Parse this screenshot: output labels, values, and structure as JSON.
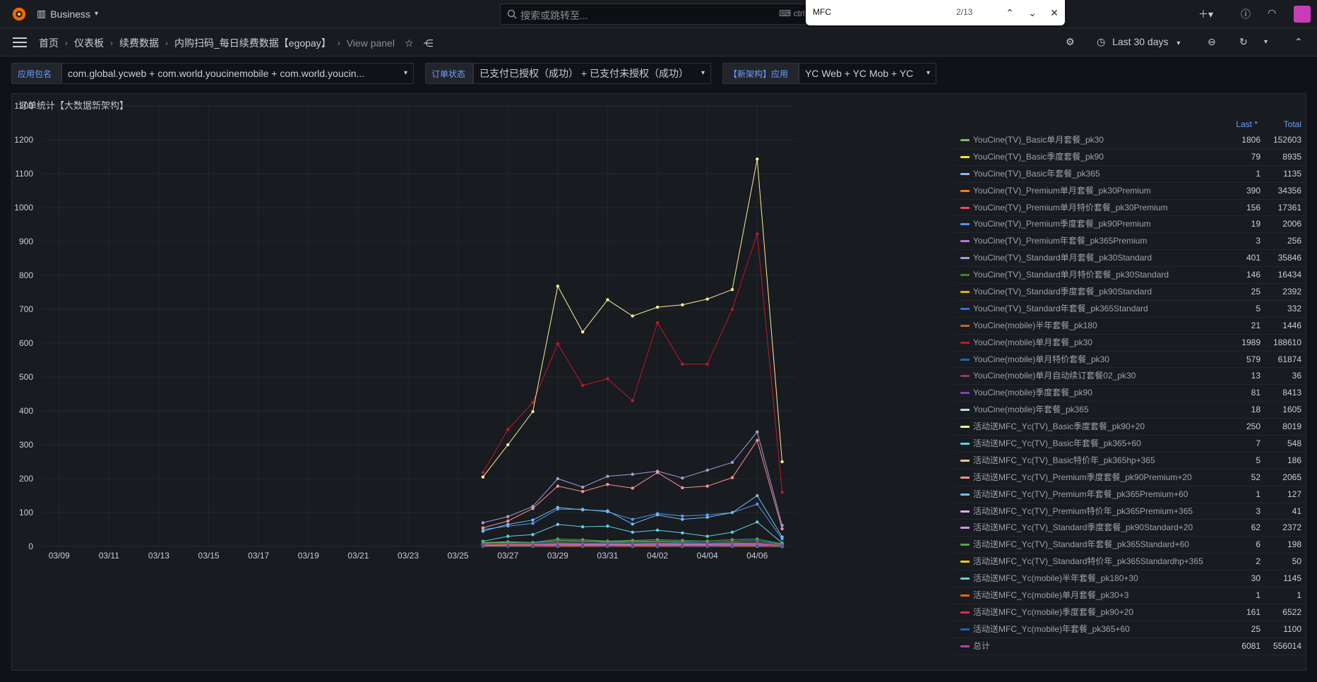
{
  "topbar": {
    "org": "Business",
    "search_placeholder": "搜索或跳转至...",
    "search_shortcut": "ctrl",
    "find": {
      "query": "MFC",
      "count": "2/13"
    }
  },
  "breadcrumb": [
    "首页",
    "仪表板",
    "续费数据",
    "内购扫码_每日续费数据【egopay】",
    "View panel"
  ],
  "time_range": "Last 30 days",
  "variables": [
    {
      "label": "应用包名",
      "value": "com.global.ycweb + com.world.youcinemobile + com.world.youcin..."
    },
    {
      "label": "订单状态",
      "value": "已支付已授权（成功） + 已支付未授权（成功）"
    },
    {
      "label": "【新架构】应用",
      "value": "YC Web + YC Mob + YC"
    }
  ],
  "panel": {
    "title": "订单统计【大数据新架构】"
  },
  "legend_header": {
    "last": "Last *",
    "total": "Total"
  },
  "colors": {
    "background": "#111217",
    "panel": "#181b1f",
    "accent": "#6e9fff"
  },
  "chart_data": {
    "type": "line",
    "x": [
      "03/26",
      "03/27",
      "03/28",
      "03/29",
      "03/30",
      "03/31",
      "04/01",
      "04/02",
      "04/03",
      "04/04",
      "04/05",
      "04/06",
      "04/07"
    ],
    "x_range": [
      "03/08",
      "04/07"
    ],
    "x_ticks": [
      "03/09",
      "03/11",
      "03/13",
      "03/15",
      "03/17",
      "03/19",
      "03/21",
      "03/23",
      "03/25",
      "03/27",
      "03/29",
      "03/31",
      "04/02",
      "04/04",
      "04/06"
    ],
    "y_ticks": [
      0,
      100,
      200,
      300,
      400,
      500,
      600,
      700,
      800,
      900,
      1000,
      1100,
      1200,
      1300
    ],
    "ylim": [
      0,
      1300
    ],
    "grid": true,
    "legend_placement": "right",
    "series": [
      {
        "name": "YouCine(TV)_Basic单月套餐_pk30",
        "color": "#73bf69",
        "last": "1806",
        "total": "152603",
        "values": [
          10,
          12,
          10,
          18,
          16,
          14,
          15,
          16,
          14,
          12,
          15,
          18,
          6
        ]
      },
      {
        "name": "YouCine(TV)_Basic季度套餐_pk90",
        "color": "#fade2a",
        "last": "79",
        "total": "8935",
        "values": [
          3,
          3,
          3,
          4,
          4,
          3,
          4,
          4,
          3,
          3,
          4,
          4,
          2
        ]
      },
      {
        "name": "YouCine(TV)_Basic年套餐_pk365",
        "color": "#8ab8ff",
        "last": "1",
        "total": "1135",
        "values": [
          1,
          1,
          1,
          1,
          1,
          1,
          1,
          1,
          1,
          1,
          1,
          1,
          0
        ]
      },
      {
        "name": "YouCine(TV)_Premium单月套餐_pk30Premium",
        "color": "#ff780a",
        "last": "390",
        "total": "34356",
        "values": [
          5,
          6,
          6,
          8,
          8,
          7,
          7,
          8,
          7,
          7,
          8,
          9,
          3
        ]
      },
      {
        "name": "YouCine(TV)_Premium单月特价套餐_pk30Premium",
        "color": "#f2495c",
        "last": "156",
        "total": "17361",
        "values": [
          3,
          4,
          4,
          5,
          5,
          4,
          5,
          5,
          4,
          4,
          5,
          6,
          2
        ]
      },
      {
        "name": "YouCine(TV)_Premium季度套餐_pk90Premium",
        "color": "#5794f2",
        "last": "19",
        "total": "2006",
        "values": [
          50,
          60,
          68,
          110,
          110,
          102,
          80,
          97,
          90,
          93,
          100,
          125,
          22
        ]
      },
      {
        "name": "YouCine(TV)_Premium年套餐_pk365Premium",
        "color": "#b877d9",
        "last": "3",
        "total": "256",
        "values": [
          1,
          1,
          1,
          1,
          1,
          1,
          1,
          1,
          1,
          1,
          1,
          1,
          0
        ]
      },
      {
        "name": "YouCine(TV)_Standard单月套餐_pk30Standard",
        "color": "#9f9fd6",
        "last": "401",
        "total": "35846",
        "values": [
          70,
          88,
          118,
          200,
          175,
          207,
          213,
          222,
          202,
          225,
          248,
          338,
          62
        ]
      },
      {
        "name": "YouCine(TV)_Standard单月特价套餐_pk30Standard",
        "color": "#37872d",
        "last": "146",
        "total": "16434",
        "values": [
          6,
          8,
          8,
          12,
          10,
          10,
          11,
          11,
          10,
          9,
          11,
          14,
          4
        ]
      },
      {
        "name": "YouCine(TV)_Standard季度套餐_pk90Standard",
        "color": "#e0b400",
        "last": "25",
        "total": "2392",
        "values": [
          2,
          2,
          2,
          3,
          3,
          2,
          3,
          3,
          2,
          2,
          3,
          3,
          1
        ]
      },
      {
        "name": "YouCine(TV)_Standard年套餐_pk365Standard",
        "color": "#3274d9",
        "last": "5",
        "total": "332",
        "values": [
          1,
          1,
          1,
          1,
          1,
          1,
          1,
          1,
          1,
          1,
          1,
          1,
          0
        ]
      },
      {
        "name": "YouCine(mobile)半年套餐_pk180",
        "color": "#c4632c",
        "last": "21",
        "total": "1446",
        "values": [
          2,
          2,
          2,
          3,
          3,
          2,
          3,
          3,
          2,
          2,
          3,
          3,
          1
        ]
      },
      {
        "name": "YouCine(mobile)单月套餐_pk30",
        "color": "#c4162a",
        "last": "1989",
        "total": "188610",
        "values": [
          218,
          345,
          425,
          598,
          475,
          495,
          430,
          660,
          538,
          538,
          700,
          922,
          160
        ]
      },
      {
        "name": "YouCine(mobile)单月特价套餐_pk30",
        "color": "#1f60c4",
        "last": "579",
        "total": "61874",
        "values": [
          8,
          10,
          10,
          15,
          14,
          12,
          13,
          14,
          12,
          12,
          14,
          18,
          5
        ]
      },
      {
        "name": "YouCine(mobile)单月自动续订套餐02_pk30",
        "color": "#8f3b5c",
        "last": "13",
        "total": "36",
        "values": [
          0,
          0,
          0,
          1,
          1,
          1,
          1,
          1,
          1,
          1,
          1,
          1,
          0
        ]
      },
      {
        "name": "YouCine(mobile)季度套餐_pk90",
        "color": "#8f3bb8",
        "last": "81",
        "total": "8413",
        "values": [
          3,
          4,
          4,
          5,
          5,
          4,
          5,
          5,
          4,
          4,
          5,
          6,
          2
        ]
      },
      {
        "name": "YouCine(mobile)年套餐_pk365",
        "color": "#badff4",
        "last": "18",
        "total": "1605",
        "values": [
          1,
          1,
          1,
          2,
          2,
          1,
          2,
          2,
          1,
          1,
          2,
          2,
          1
        ]
      },
      {
        "name": "活动送MFC_Yc(TV)_Basic季度套餐_pk90+20",
        "color": "#ffee95",
        "last": "250",
        "total": "8019",
        "values": [
          205,
          300,
          398,
          768,
          633,
          728,
          680,
          706,
          713,
          730,
          758,
          1143,
          250
        ]
      },
      {
        "name": "活动送MFC_Yc(TV)_Basic年套餐_pk365+60",
        "color": "#5ad4e6",
        "last": "7",
        "total": "548",
        "values": [
          15,
          30,
          35,
          65,
          58,
          60,
          42,
          48,
          40,
          30,
          42,
          72,
          10
        ]
      },
      {
        "name": "活动送MFC_Yc(TV)_Basic特价年_pk365hp+365",
        "color": "#ffc385",
        "last": "5",
        "total": "186",
        "values": [
          1,
          1,
          1,
          1,
          1,
          1,
          1,
          1,
          1,
          1,
          1,
          1,
          0
        ]
      },
      {
        "name": "活动送MFC_Yc(TV)_Premium季度套餐_pk90Premium+20",
        "color": "#ff8f8f",
        "last": "52",
        "total": "2065",
        "values": [
          55,
          75,
          112,
          178,
          162,
          183,
          172,
          218,
          173,
          178,
          203,
          313,
          52
        ]
      },
      {
        "name": "活动送MFC_Yc(TV)_Premium年套餐_pk365Premium+60",
        "color": "#73bdf0",
        "last": "1",
        "total": "127",
        "values": [
          45,
          65,
          78,
          115,
          108,
          105,
          66,
          93,
          80,
          86,
          100,
          150,
          28
        ]
      },
      {
        "name": "活动送MFC_Yc(TV)_Premium特价年_pk365Premium+365",
        "color": "#e8a6e8",
        "last": "3",
        "total": "41",
        "values": [
          1,
          1,
          1,
          1,
          1,
          1,
          1,
          1,
          1,
          1,
          1,
          1,
          0
        ]
      },
      {
        "name": "活动送MFC_Yc(TV)_Standard季度套餐_pk90Standard+20",
        "color": "#ca95e5",
        "last": "62",
        "total": "2372",
        "values": [
          4,
          5,
          5,
          7,
          6,
          6,
          6,
          7,
          6,
          6,
          7,
          8,
          3
        ]
      },
      {
        "name": "活动送MFC_Yc(TV)_Standard年套餐_pk365Standard+60",
        "color": "#56a64b",
        "last": "6",
        "total": "198",
        "values": [
          12,
          14,
          12,
          22,
          20,
          16,
          18,
          20,
          18,
          16,
          20,
          22,
          8
        ]
      },
      {
        "name": "活动送MFC_Yc(TV)_Standard特价年_pk365Standardhp+365",
        "color": "#f2cc0c",
        "last": "2",
        "total": "50",
        "values": [
          1,
          1,
          1,
          1,
          1,
          1,
          1,
          1,
          1,
          1,
          1,
          1,
          0
        ]
      },
      {
        "name": "活动送MFC_Yc(mobile)半年套餐_pk180+30",
        "color": "#6ccadc",
        "last": "30",
        "total": "1145",
        "values": [
          2,
          2,
          2,
          3,
          3,
          2,
          3,
          3,
          2,
          2,
          3,
          3,
          1
        ]
      },
      {
        "name": "活动送MFC_Yc(mobile)单月套餐_pk30+3",
        "color": "#fa6400",
        "last": "1",
        "total": "1",
        "values": [
          0,
          0,
          0,
          0,
          0,
          0,
          0,
          0,
          0,
          0,
          0,
          0,
          1
        ]
      },
      {
        "name": "活动送MFC_Yc(mobile)季度套餐_pk90+20",
        "color": "#e02f44",
        "last": "161",
        "total": "6522",
        "values": [
          5,
          6,
          6,
          9,
          8,
          8,
          8,
          9,
          8,
          8,
          9,
          10,
          3
        ]
      },
      {
        "name": "活动送MFC_Yc(mobile)年套餐_pk365+60",
        "color": "#1f60c4",
        "last": "25",
        "total": "1100",
        "values": [
          1,
          1,
          1,
          2,
          2,
          1,
          2,
          2,
          1,
          1,
          2,
          2,
          1
        ]
      },
      {
        "name": "总计",
        "color": "#b83bb8",
        "last": "6081",
        "total": "556014",
        "values": []
      }
    ]
  }
}
